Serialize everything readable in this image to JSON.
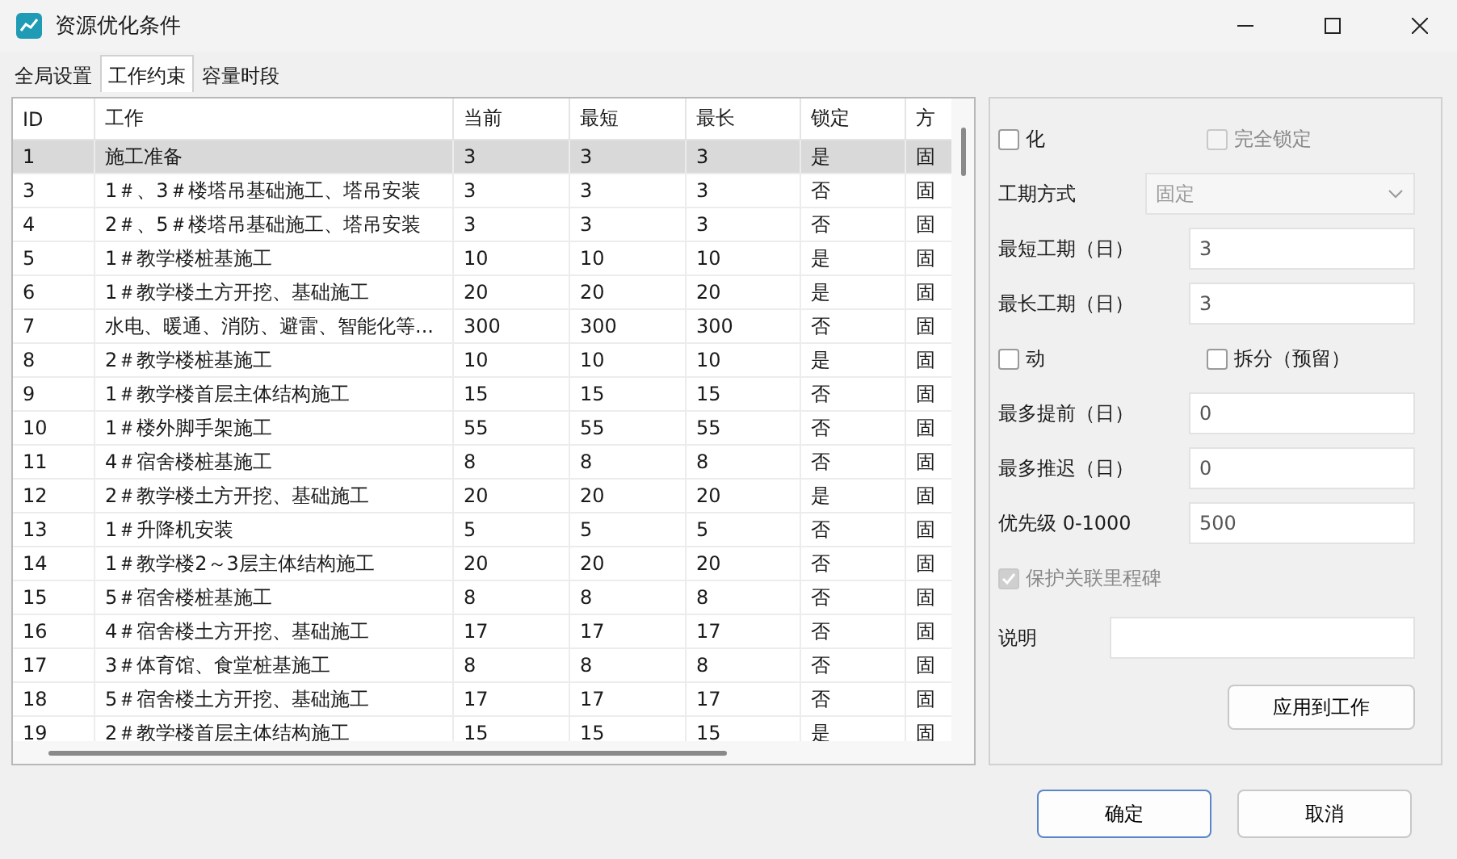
{
  "window": {
    "title": "资源优化条件"
  },
  "tabs": [
    {
      "label": "全局设置",
      "selected": false
    },
    {
      "label": "工作约束",
      "selected": true
    },
    {
      "label": "容量时段",
      "selected": false
    }
  ],
  "table": {
    "columns": [
      "ID",
      "工作",
      "当前",
      "最短",
      "最长",
      "锁定",
      "方"
    ],
    "rows": [
      {
        "cells": [
          "1",
          "施工准备",
          "3",
          "3",
          "3",
          "是",
          "固"
        ],
        "selected": true
      },
      {
        "cells": [
          "3",
          "1＃、3＃楼塔吊基础施工、塔吊安装",
          "3",
          "3",
          "3",
          "否",
          "固"
        ],
        "selected": false
      },
      {
        "cells": [
          "4",
          "2＃、5＃楼塔吊基础施工、塔吊安装",
          "3",
          "3",
          "3",
          "否",
          "固"
        ],
        "selected": false
      },
      {
        "cells": [
          "5",
          "1＃教学楼桩基施工",
          "10",
          "10",
          "10",
          "是",
          "固"
        ],
        "selected": false
      },
      {
        "cells": [
          "6",
          "1＃教学楼土方开挖、基础施工",
          "20",
          "20",
          "20",
          "是",
          "固"
        ],
        "selected": false
      },
      {
        "cells": [
          "7",
          "水电、暖通、消防、避雷、智能化等...",
          "300",
          "300",
          "300",
          "否",
          "固"
        ],
        "selected": false
      },
      {
        "cells": [
          "8",
          "2＃教学楼桩基施工",
          "10",
          "10",
          "10",
          "是",
          "固"
        ],
        "selected": false
      },
      {
        "cells": [
          "9",
          "1＃教学楼首层主体结构施工",
          "15",
          "15",
          "15",
          "否",
          "固"
        ],
        "selected": false
      },
      {
        "cells": [
          "10",
          "1＃楼外脚手架施工",
          "55",
          "55",
          "55",
          "否",
          "固"
        ],
        "selected": false
      },
      {
        "cells": [
          "11",
          "4＃宿舍楼桩基施工",
          "8",
          "8",
          "8",
          "否",
          "固"
        ],
        "selected": false
      },
      {
        "cells": [
          "12",
          "2＃教学楼土方开挖、基础施工",
          "20",
          "20",
          "20",
          "是",
          "固"
        ],
        "selected": false
      },
      {
        "cells": [
          "13",
          "1＃升降机安装",
          "5",
          "5",
          "5",
          "否",
          "固"
        ],
        "selected": false
      },
      {
        "cells": [
          "14",
          "1＃教学楼2～3层主体结构施工",
          "20",
          "20",
          "20",
          "否",
          "固"
        ],
        "selected": false
      },
      {
        "cells": [
          "15",
          "5＃宿舍楼桩基施工",
          "8",
          "8",
          "8",
          "否",
          "固"
        ],
        "selected": false
      },
      {
        "cells": [
          "16",
          "4＃宿舍楼土方开挖、基础施工",
          "17",
          "17",
          "17",
          "否",
          "固"
        ],
        "selected": false
      },
      {
        "cells": [
          "17",
          "3＃体育馆、食堂桩基施工",
          "8",
          "8",
          "8",
          "否",
          "固"
        ],
        "selected": false
      },
      {
        "cells": [
          "18",
          "5＃宿舍楼土方开挖、基础施工",
          "17",
          "17",
          "17",
          "否",
          "固"
        ],
        "selected": false
      },
      {
        "cells": [
          "19",
          "2＃教学楼首层主体结构施工",
          "15",
          "15",
          "15",
          "是",
          "固"
        ],
        "selected": false
      }
    ]
  },
  "panel": {
    "rows": [
      {
        "kind": "checks",
        "items": [
          {
            "label": "化",
            "checked": false,
            "disabled": false
          },
          {
            "label": "完全锁定",
            "checked": false,
            "disabled": true
          }
        ]
      },
      {
        "kind": "select",
        "label": "工期方式",
        "value": "固定",
        "disabled": true
      },
      {
        "kind": "field",
        "label": "最短工期（日）",
        "value": "3"
      },
      {
        "kind": "field",
        "label": "最长工期（日）",
        "value": "3"
      },
      {
        "kind": "checks",
        "items": [
          {
            "label": "动",
            "checked": false,
            "disabled": false
          },
          {
            "label": "拆分（预留）",
            "checked": false,
            "disabled": false
          }
        ]
      },
      {
        "kind": "field",
        "label": "最多提前（日）",
        "value": "0"
      },
      {
        "kind": "field",
        "label": "最多推迟（日）",
        "value": "0"
      },
      {
        "kind": "field",
        "label": "优先级 0-1000",
        "value": "500"
      },
      {
        "kind": "checks",
        "items": [
          {
            "label": "保护关联里程碑",
            "checked": true,
            "disabled": true
          }
        ]
      },
      {
        "kind": "wide",
        "label": "说明",
        "value": ""
      },
      {
        "kind": "button",
        "label": "应用到工作"
      }
    ]
  },
  "buttons": [
    {
      "label": "确定",
      "primary": true
    },
    {
      "label": "取消",
      "primary": false
    }
  ]
}
